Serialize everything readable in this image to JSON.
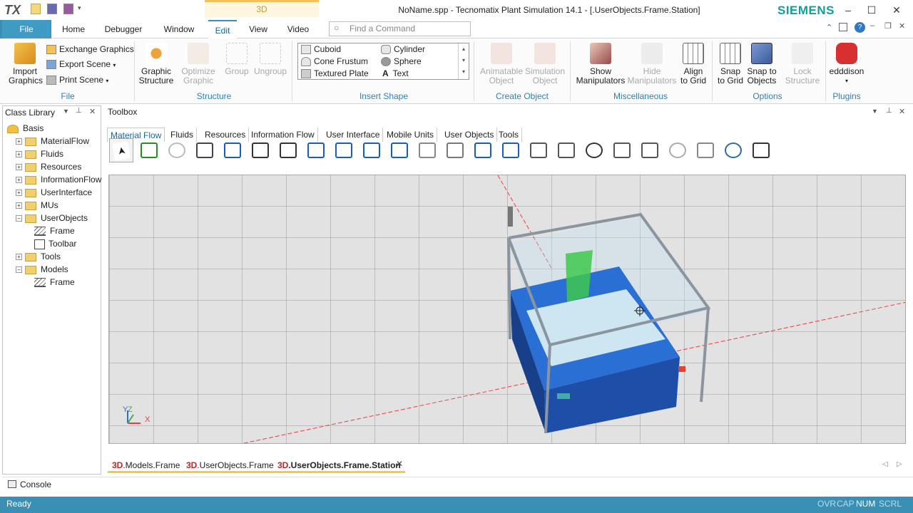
{
  "app": {
    "logo": "TX",
    "title": "NoName.spp - Tecnomatix Plant Simulation 14.1 - [.UserObjects.Frame.Station]",
    "context_tab": "3D",
    "brand": "SIEMENS"
  },
  "menu": {
    "file": "File",
    "tabs": [
      "Home",
      "Debugger",
      "Window",
      "Edit",
      "View",
      "Video"
    ],
    "active": "Edit",
    "find_placeholder": "Find a Command"
  },
  "ribbon": {
    "file_group": {
      "import": [
        "Import",
        "Graphics"
      ],
      "exchange": "Exchange Graphics",
      "export": "Export Scene",
      "print": "Print Scene",
      "label": "File"
    },
    "structure_group": {
      "graphic_structure": [
        "Graphic",
        "Structure"
      ],
      "optimize": [
        "Optimize",
        "Graphic"
      ],
      "group": "Group",
      "ungroup": "Ungroup",
      "label": "Structure"
    },
    "shapes": {
      "items": [
        "Cuboid",
        "Cylinder",
        "Cone Frustum",
        "Sphere",
        "Textured Plate",
        "Text"
      ],
      "label": "Insert Shape"
    },
    "create_group": {
      "animatable": [
        "Animatable",
        "Object"
      ],
      "simulation": [
        "Simulation",
        "Object"
      ],
      "label": "Create Object"
    },
    "misc_group": {
      "show": [
        "Show",
        "Manipulators"
      ],
      "hide": [
        "Hide",
        "Manipulators"
      ],
      "align": [
        "Align",
        "to Grid"
      ],
      "label": "Miscellaneous"
    },
    "options_group": {
      "snap_grid": [
        "Snap",
        "to Grid"
      ],
      "snap_objects": [
        "Snap to",
        "Objects"
      ],
      "lock": [
        "Lock",
        "Structure"
      ],
      "label": "Options"
    },
    "plugins_group": {
      "edd": "edddison",
      "label": "Plugins"
    }
  },
  "class_library": {
    "title": "Class Library",
    "items": [
      {
        "label": "Basis",
        "kind": "root"
      },
      {
        "label": "MaterialFlow",
        "kind": "folder"
      },
      {
        "label": "Fluids",
        "kind": "folder"
      },
      {
        "label": "Resources",
        "kind": "folder"
      },
      {
        "label": "InformationFlow",
        "kind": "folder"
      },
      {
        "label": "UserInterface",
        "kind": "folder"
      },
      {
        "label": "MUs",
        "kind": "folder"
      },
      {
        "label": "UserObjects",
        "kind": "folder-open"
      },
      {
        "label": "Frame",
        "kind": "frame"
      },
      {
        "label": "Toolbar",
        "kind": "toolbar"
      },
      {
        "label": "Tools",
        "kind": "folder"
      },
      {
        "label": "Models",
        "kind": "folder-open"
      },
      {
        "label": "Frame",
        "kind": "frame"
      }
    ]
  },
  "toolbox": {
    "title": "Toolbox",
    "tabs": [
      "Material Flow",
      "Fluids",
      "Resources",
      "Information Flow",
      "User Interface",
      "Mobile Units",
      "User Objects",
      "Tools"
    ],
    "active": "Material Flow",
    "tool_count": 24
  },
  "viewport": {
    "axis_labels": [
      "Y",
      "Z",
      "X"
    ]
  },
  "doc_tabs": [
    {
      "badge": "3D",
      "label": ".Models.Frame"
    },
    {
      "badge": "3D",
      "label": ".UserObjects.Frame"
    },
    {
      "badge": "3D",
      "label": ".UserObjects.Frame.Station"
    }
  ],
  "console": {
    "label": "Console"
  },
  "status": {
    "text": "Ready",
    "indicators": [
      "OVR",
      "CAP",
      "NUM",
      "SCRL"
    ],
    "active_indicator": "NUM"
  },
  "colors": {
    "accent": "#3a8fb4",
    "brand": "#119e9e",
    "tab_highlight": "#f5c84c"
  }
}
